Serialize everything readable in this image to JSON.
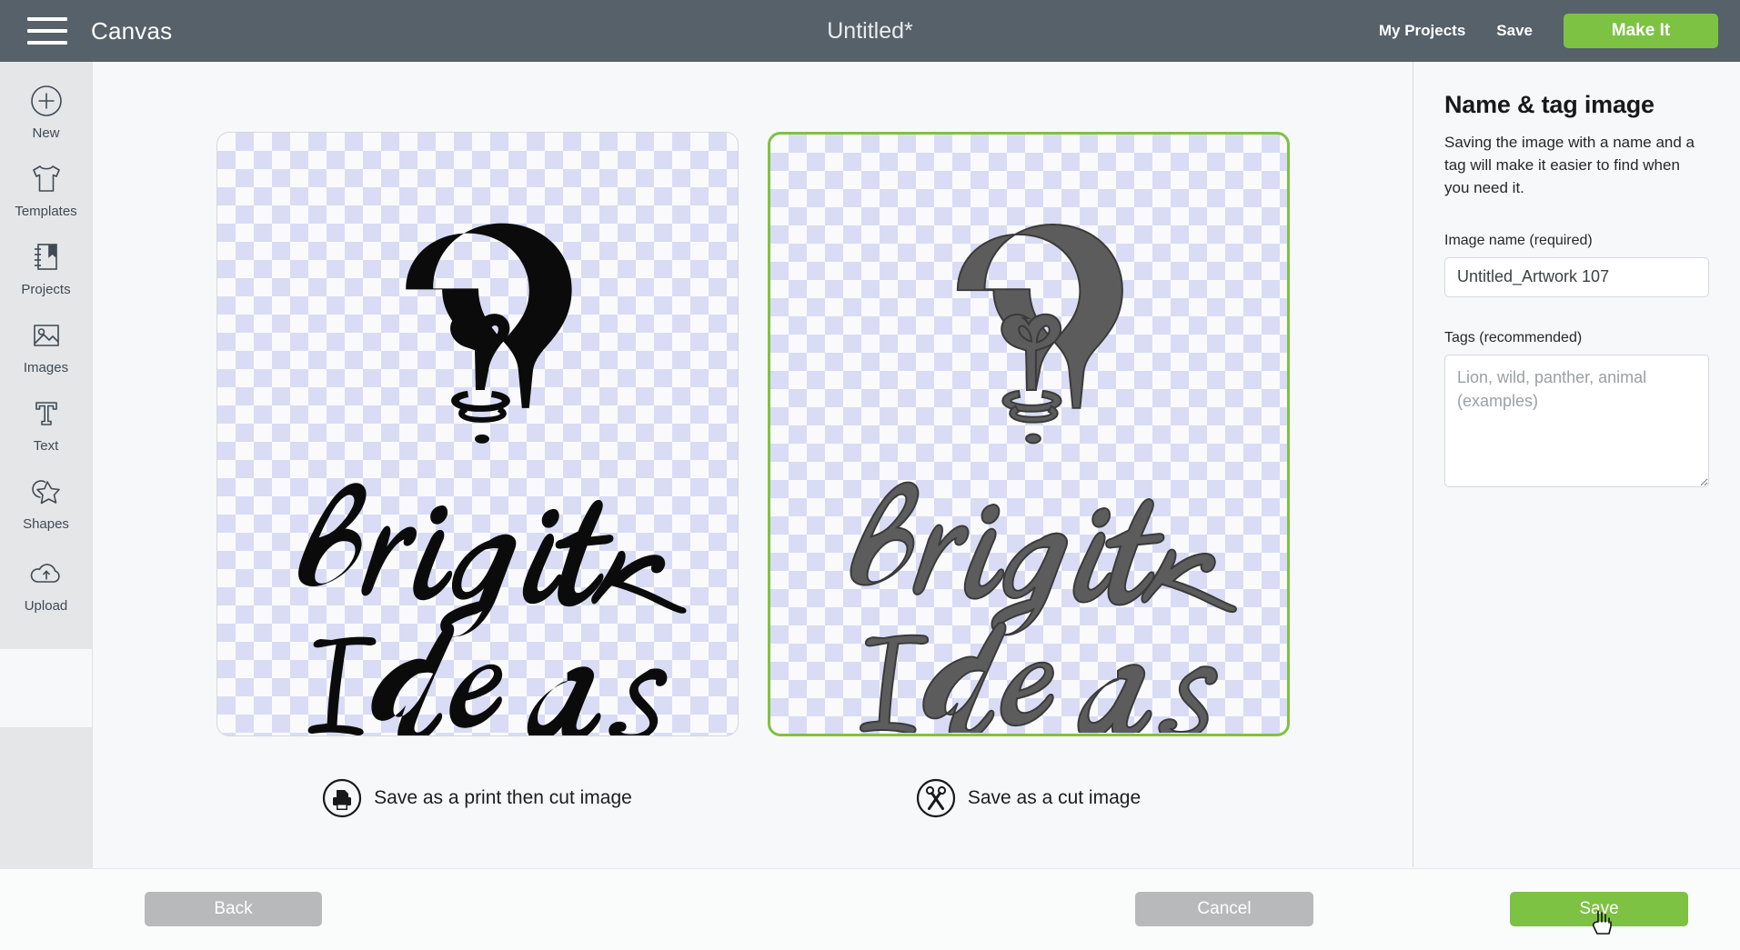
{
  "header": {
    "menu_icon": "hamburger-icon",
    "app_title": "Canvas",
    "document_title": "Untitled*",
    "my_projects_label": "My Projects",
    "save_label": "Save",
    "make_it_label": "Make It",
    "bg_color": "#56616a",
    "accent_green": "#7dc243"
  },
  "sidebar": {
    "items": [
      {
        "label": "New",
        "icon": "plus-circle-icon",
        "active": false
      },
      {
        "label": "Templates",
        "icon": "tshirt-icon",
        "active": false
      },
      {
        "label": "Projects",
        "icon": "notebook-bookmark-icon",
        "active": false
      },
      {
        "label": "Images",
        "icon": "picture-icon",
        "active": false
      },
      {
        "label": "Text",
        "icon": "text-t-icon",
        "active": false
      },
      {
        "label": "Shapes",
        "icon": "shapes-star-icon",
        "active": false
      },
      {
        "label": "Upload",
        "icon": "cloud-upload-icon",
        "active": false
      }
    ]
  },
  "main": {
    "options": [
      {
        "id": "print-then-cut",
        "label": "Save as a print then cut image",
        "icon": "printer-circle-icon",
        "selected": false,
        "artwork_color": "#000000",
        "artwork_alt": "Bright Ideas lightbulb lettering, black fill"
      },
      {
        "id": "cut-image",
        "label": "Save as a cut image",
        "icon": "scissors-circle-icon",
        "selected": true,
        "artwork_color": "#5c5c5c",
        "artwork_alt": "Bright Ideas lightbulb lettering, gray fill"
      }
    ],
    "artwork_text_line1": "Bright",
    "artwork_text_line2": "Ideas",
    "selected_border_color": "#7dc243",
    "checker_color": "#d9dcf4"
  },
  "right_panel": {
    "title": "Name & tag image",
    "description": "Saving the image with a name and a tag will make it easier to find when you need it.",
    "image_name_label": "Image name (required)",
    "image_name_value": "Untitled_Artwork 107",
    "image_name_placeholder": "",
    "tags_label": "Tags (recommended)",
    "tags_value": "",
    "tags_placeholder": "Lion, wild, panther, animal (examples)"
  },
  "footer": {
    "back_label": "Back",
    "cancel_label": "Cancel",
    "save_label": "Save",
    "disabled_color": "#b7b9bb",
    "save_color": "#7dc243"
  }
}
